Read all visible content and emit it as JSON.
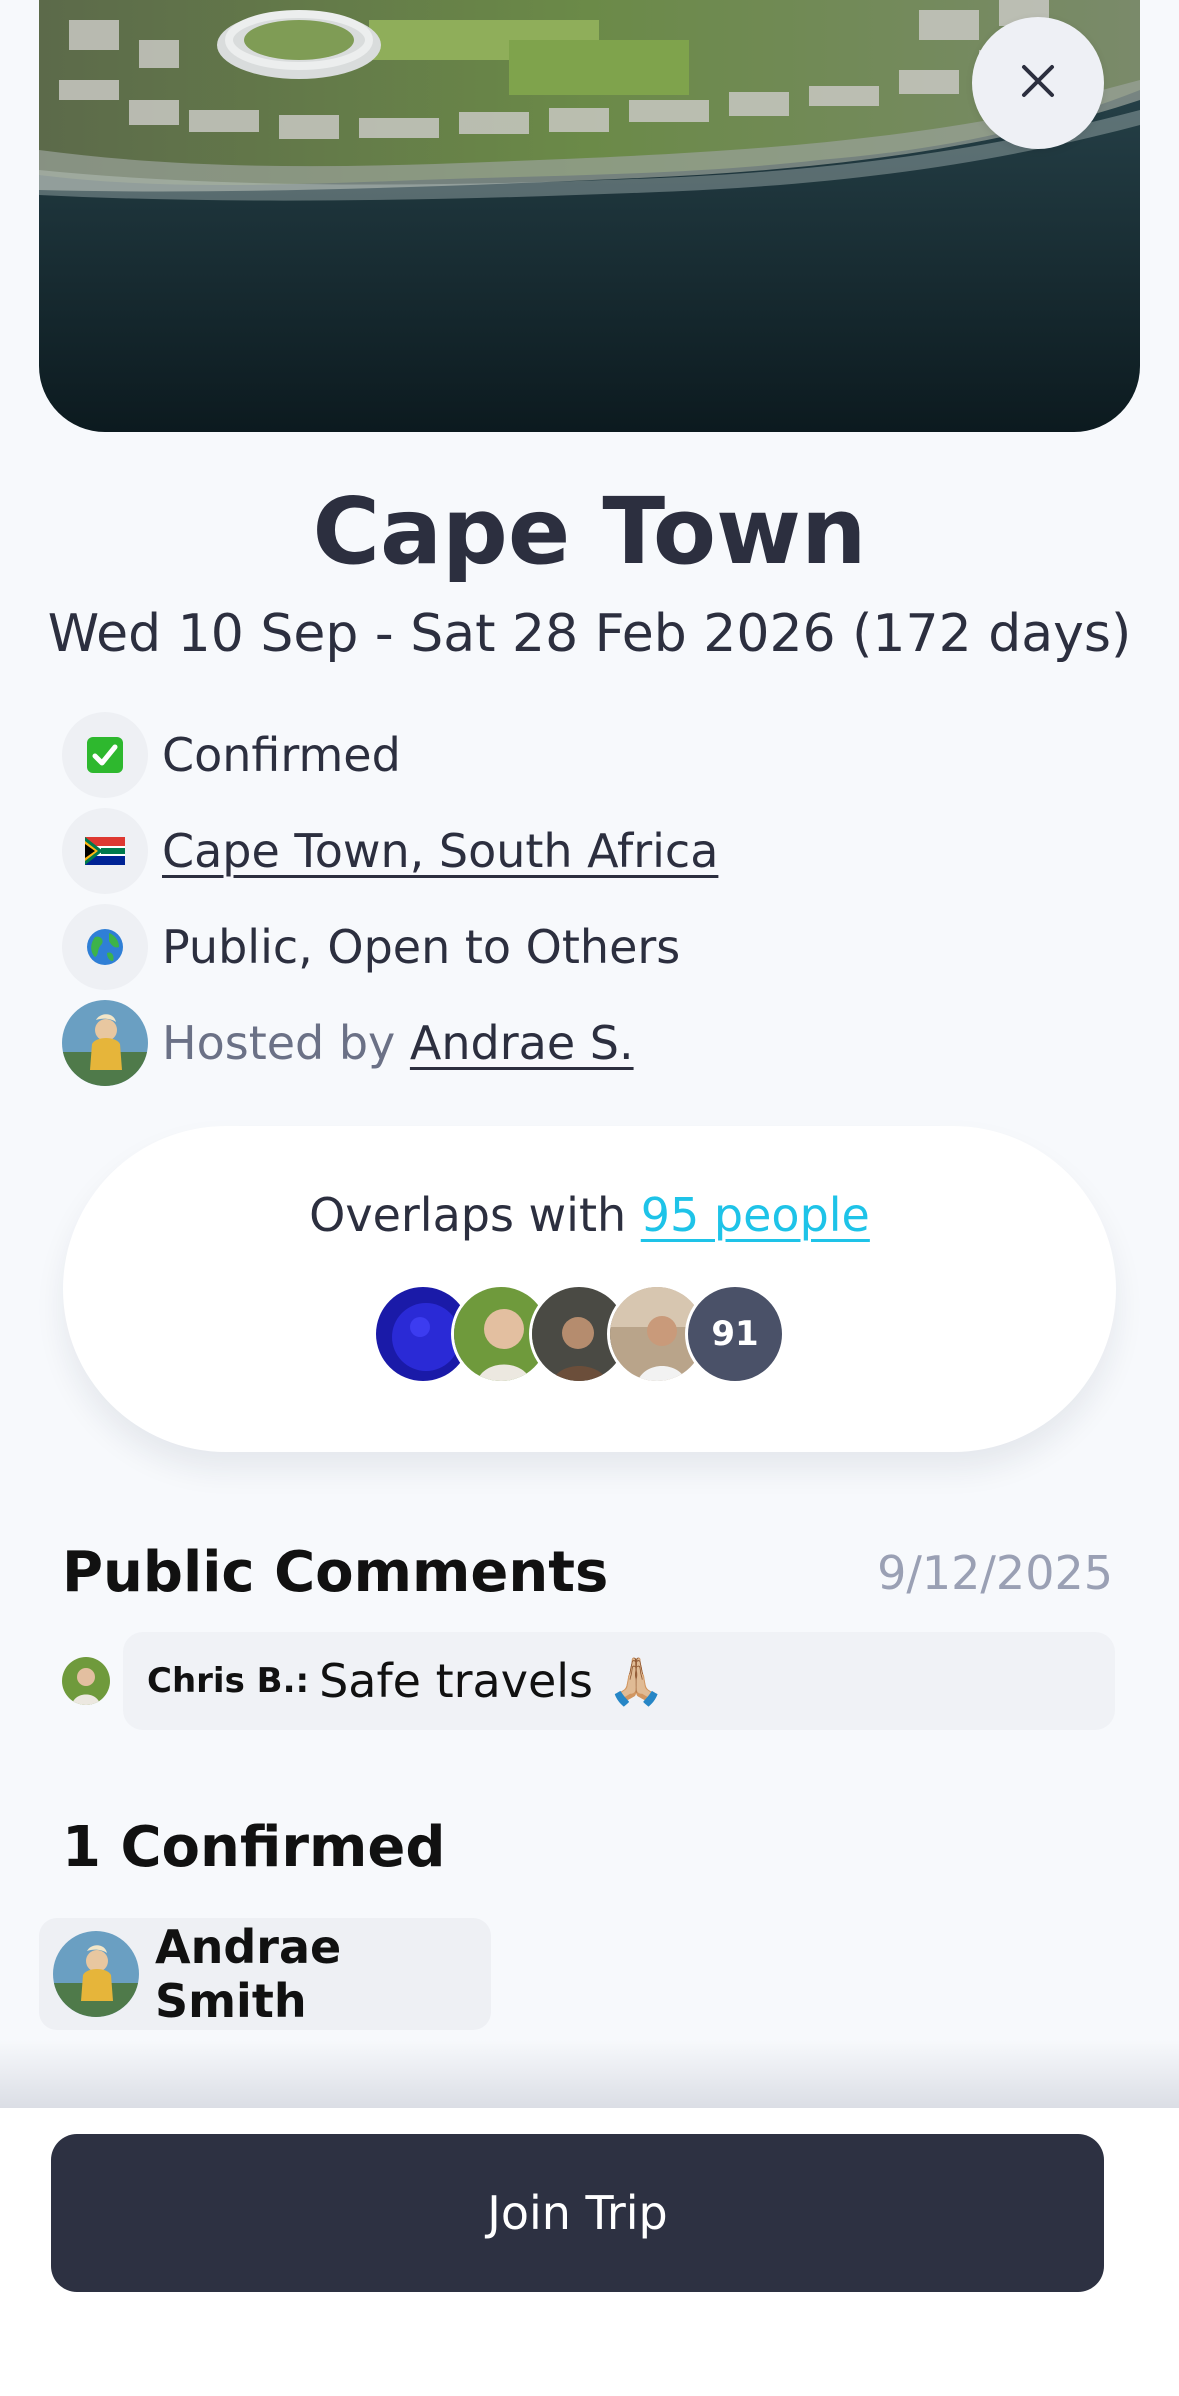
{
  "trip": {
    "title": "Cape Town",
    "dates": "Wed 10 Sep - Sat 28 Feb 2026 (172 days)"
  },
  "info": {
    "status": "Confirmed",
    "status_icon": "✅",
    "location": "Cape Town, South Africa",
    "location_icon": "flag-south-africa",
    "visibility": "Public, Open to Others",
    "visibility_icon": "🌎",
    "hosted_label": "Hosted by",
    "host_name": "Andrae S."
  },
  "overlap": {
    "label": "Overlaps with",
    "link": "95 people",
    "extra_count": "91"
  },
  "comments": {
    "title": "Public Comments",
    "date": "9/12/2025",
    "items": [
      {
        "author": "Chris  B.:",
        "text": "Safe travels 🙏🏼"
      }
    ]
  },
  "confirmed": {
    "title": "1 Confirmed",
    "members": [
      {
        "name": "Andrae Smith"
      }
    ]
  },
  "actions": {
    "join_label": "Join Trip"
  },
  "colors": {
    "primary": "#2d3142",
    "link_accent": "#1ec3e8",
    "muted": "#9aa0b4"
  }
}
